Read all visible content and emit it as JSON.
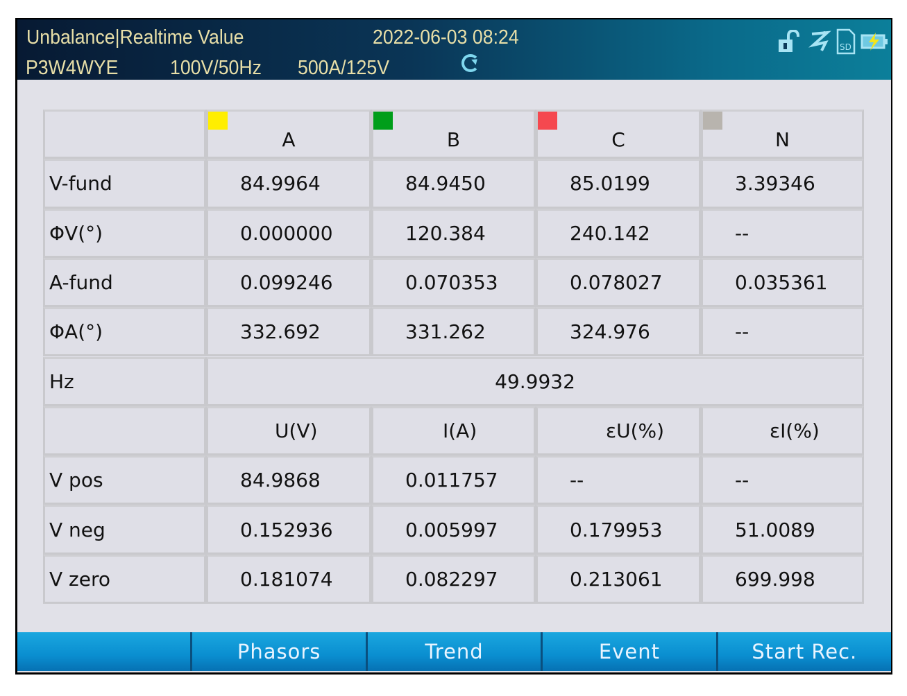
{
  "header": {
    "title": "Unbalance|Realtime Value",
    "datetime": "2022-06-03 08:24",
    "wiring": "P3W4WYE",
    "voltage": "100V/50Hz",
    "current": "500A/125V"
  },
  "status_icons": [
    "unlock-icon",
    "running-icon",
    "sd-card-icon",
    "battery-charging-icon"
  ],
  "phase_colors": {
    "A": "#ffee00",
    "B": "#009e1a",
    "C": "#f5484f",
    "N": "#b8b4ae"
  },
  "table": {
    "phase_headers": [
      "A",
      "B",
      "C",
      "N"
    ],
    "rows": [
      {
        "label": "V-fund",
        "values": [
          "84.9964",
          "84.9450",
          "85.0199",
          "3.39346"
        ]
      },
      {
        "label": "ΦV(°)",
        "values": [
          "0.000000",
          "120.384",
          "240.142",
          "--"
        ]
      },
      {
        "label": "A-fund",
        "values": [
          "0.099246",
          "0.070353",
          "0.078027",
          "0.035361"
        ]
      },
      {
        "label": "ΦA(°)",
        "values": [
          "332.692",
          "331.262",
          "324.976",
          "--"
        ]
      }
    ],
    "hz": {
      "label": "Hz",
      "value": "49.9932"
    },
    "seq_headers": [
      "U(V)",
      "I(A)",
      "εU(%)",
      "εI(%)"
    ],
    "seq_rows": [
      {
        "label": "V  pos",
        "values": [
          "84.9868",
          "0.011757",
          "--",
          "--"
        ]
      },
      {
        "label": "V  neg",
        "values": [
          "0.152936",
          "0.005997",
          "0.179953",
          "51.0089"
        ]
      },
      {
        "label": "V  zero",
        "values": [
          "0.181074",
          "0.082297",
          "0.213061",
          "699.998"
        ]
      }
    ]
  },
  "bottom_bar": [
    "",
    "Phasors",
    "Trend",
    "Event",
    "Start  Rec."
  ]
}
